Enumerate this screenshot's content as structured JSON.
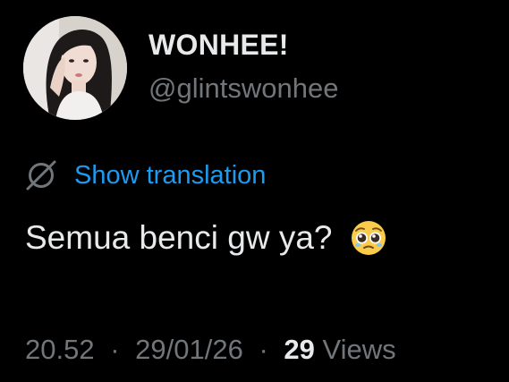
{
  "profile": {
    "display_name": "WONHEE!",
    "handle": "@glintswonhee",
    "avatar_icon": "profile-photo"
  },
  "tweet": {
    "translate_link": "Show translation",
    "translate_icon": "globe-slash-icon",
    "text": "Semua benci gw ya?",
    "emoji": "pleading-face-icon"
  },
  "meta": {
    "time": "20.52",
    "separator": "·",
    "date": "29/01/26",
    "views_count": "29",
    "views_label": "Views"
  },
  "colors": {
    "background": "#000000",
    "primary_text": "#e7e9ea",
    "secondary_text": "#71767b",
    "link": "#1d9bf0"
  }
}
